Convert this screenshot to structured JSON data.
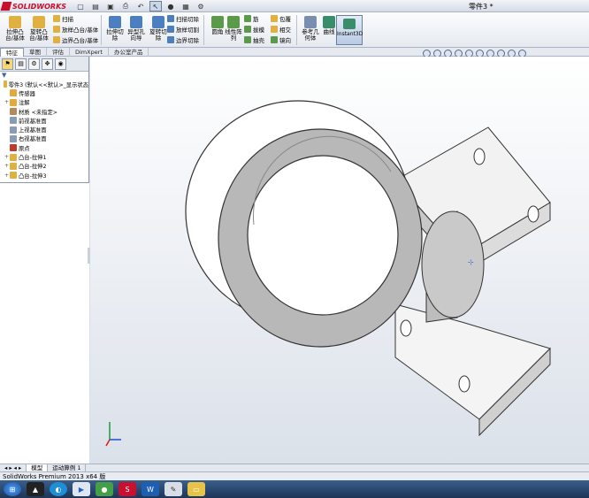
{
  "app": {
    "brand": "SOLIDWORKS",
    "doc_title": "零件3 *"
  },
  "ribbon": {
    "big_buttons": [
      {
        "label1": "拉伸凸",
        "label2": "台/基体",
        "color": "#e0b040"
      },
      {
        "label1": "旋转凸",
        "label2": "台/基体",
        "color": "#e0b040"
      },
      {
        "label1": "拉伸切",
        "label2": "除",
        "color": "#4c7fc0"
      },
      {
        "label1": "异型孔",
        "label2": "向导",
        "color": "#4c7fc0"
      },
      {
        "label1": "旋转切",
        "label2": "除",
        "color": "#4c7fc0"
      }
    ],
    "sweep_group": [
      "扫描",
      "放样凸台/基体",
      "边界凸台/基体"
    ],
    "cut_group": [
      "扫描切除",
      "放样切割",
      "边界切除"
    ],
    "fillet_label": "圆角",
    "pattern_label1": "线性阵",
    "pattern_label2": "列",
    "feature_col1": [
      "筋",
      "拔模",
      "抽壳"
    ],
    "feature_col2": [
      "包覆",
      "相交",
      "镜向"
    ],
    "ref_geom1": "参考几",
    "ref_geom2": "何体",
    "curves": "曲线",
    "instant3d": "Instant3D"
  },
  "cmd_tabs": [
    "特征",
    "草图",
    "评估",
    "DimXpert",
    "办公室产品"
  ],
  "tree": {
    "root": "零件3 (默认<<默认>_显示状态",
    "items": [
      {
        "label": "传感器",
        "exp": "",
        "color": "#e6a83a"
      },
      {
        "label": "注解",
        "exp": "+",
        "color": "#e6a83a"
      },
      {
        "label": "材质 <未指定>",
        "exp": "",
        "color": "#b58a5a"
      },
      {
        "label": "前视基准面",
        "exp": "",
        "color": "#8a9bb5"
      },
      {
        "label": "上视基准面",
        "exp": "",
        "color": "#8a9bb5"
      },
      {
        "label": "右视基准面",
        "exp": "",
        "color": "#8a9bb5"
      },
      {
        "label": "原点",
        "exp": "",
        "color": "#c0392b"
      },
      {
        "label": "凸台-拉伸1",
        "exp": "+",
        "color": "#e0b040"
      },
      {
        "label": "凸台-拉伸2",
        "exp": "+",
        "color": "#e0b040"
      },
      {
        "label": "凸台-拉伸3",
        "exp": "+",
        "color": "#e0b040"
      }
    ]
  },
  "model_tabs": [
    "模型",
    "运动算例 1"
  ],
  "status": "SolidWorks Premium 2013 x64 版"
}
